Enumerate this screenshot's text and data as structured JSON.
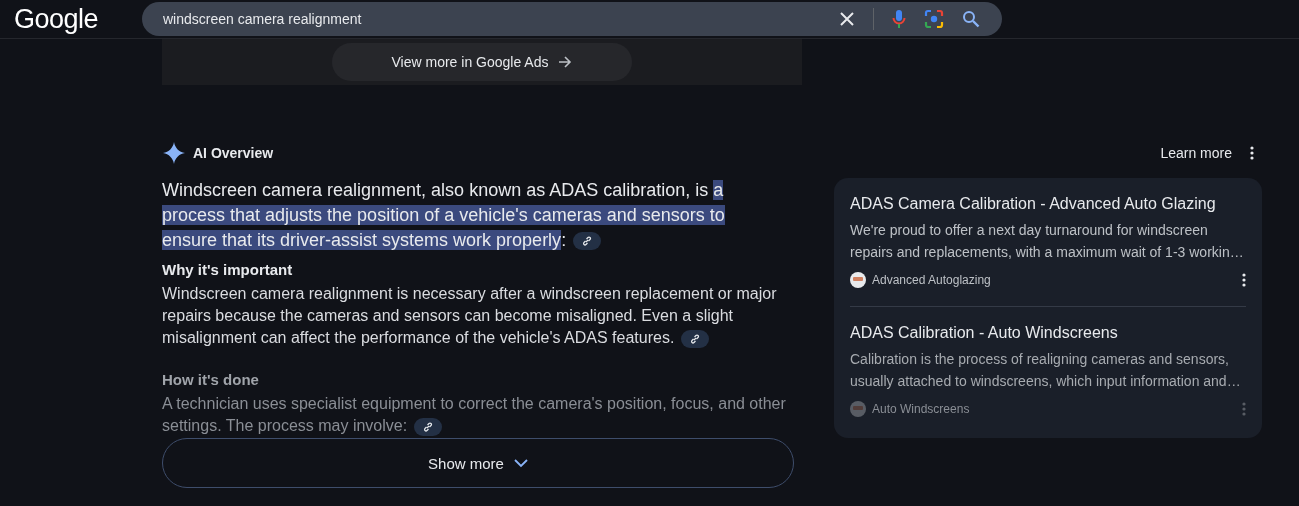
{
  "header": {
    "logo": "Google",
    "search": {
      "value": "windscreen camera realignment"
    }
  },
  "ads": {
    "button": "View more in Google Ads"
  },
  "overview": {
    "title": "AI Overview",
    "learn_more": "Learn more",
    "lead": {
      "text": "Windscreen camera realignment, also known as ADAS calibration, is ",
      "highlight": "a process that adjusts the position of a vehicle's cameras and sensors to ensure that its driver-assist systems work properly",
      "tail": ":"
    },
    "sections": [
      {
        "heading": "Why it's important",
        "body": "Windscreen camera realignment is necessary after a windscreen replacement or major repairs because the cameras and sensors can become misaligned. Even a slight misalignment can affect the performance of the vehicle's ADAS features.",
        "faded": false
      },
      {
        "heading": "How it's done",
        "body": "A technician uses specialist equipment to correct the camera's position, focus, and other settings. The process may involve:",
        "faded": true
      }
    ],
    "show_more": "Show more",
    "sources": [
      {
        "title": "ADAS Camera Calibration - Advanced Auto Glazing",
        "snippet": "We're proud to offer a next day turnaround for windscreen repairs and replacements, with a maximum wait of 1-3 workin…",
        "site": "Advanced Autoglazing",
        "faded": false
      },
      {
        "title": "ADAS Calibration - Auto Windscreens",
        "snippet": "Calibration is the process of realigning cameras and sensors, usually attached to windscreens, which input information and…",
        "site": "Auto Windscreens",
        "faded": true
      }
    ]
  }
}
